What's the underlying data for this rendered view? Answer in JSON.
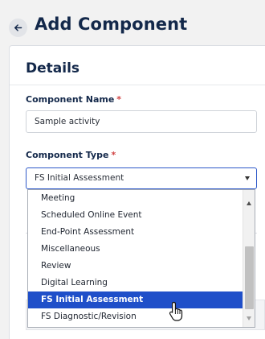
{
  "header": {
    "title": "Add Component",
    "back_icon": "arrow-left-icon"
  },
  "details": {
    "title": "Details",
    "component_name": {
      "label": "Component Name",
      "required_mark": "*",
      "value": "Sample activity"
    },
    "component_type": {
      "label": "Component Type",
      "required_mark": "*",
      "value": "FS Initial Assessment",
      "options": [
        "Meeting",
        "Scheduled Online Event",
        "End-Point Assessment",
        "Miscellaneous",
        "Review",
        "Digital Learning",
        "FS Initial Assessment",
        "FS Diagnostic/Revision"
      ],
      "highlighted_option": "FS Initial Assessment"
    }
  },
  "colors": {
    "accent": "#1f4fc9",
    "title": "#13284a",
    "required": "#d14343"
  },
  "cursor_icon": "hand-pointer-icon"
}
